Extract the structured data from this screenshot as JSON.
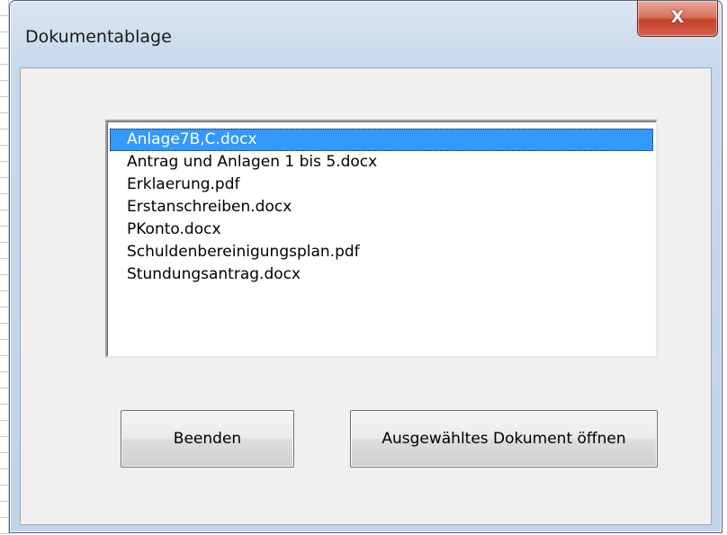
{
  "window": {
    "title": "Dokumentablage",
    "close_glyph": "X"
  },
  "listbox": {
    "items": [
      {
        "label": "Anlage7B,C.docx",
        "selected": true
      },
      {
        "label": "Antrag und Anlagen 1 bis 5.docx",
        "selected": false
      },
      {
        "label": "Erklaerung.pdf",
        "selected": false
      },
      {
        "label": "Erstanschreiben.docx",
        "selected": false
      },
      {
        "label": "PKonto.docx",
        "selected": false
      },
      {
        "label": "Schuldenbereinigungsplan.pdf",
        "selected": false
      },
      {
        "label": "Stundungsantrag.docx",
        "selected": false
      }
    ],
    "selection_color": "#3399ff"
  },
  "buttons": {
    "quit_label": "Beenden",
    "open_label": "Ausgewähltes Dokument öffnen"
  },
  "colors": {
    "close_button": "#c4412b",
    "frame": "#c7d9ec",
    "client": "#f0f0f0"
  },
  "icons": {
    "close": "close-icon"
  }
}
